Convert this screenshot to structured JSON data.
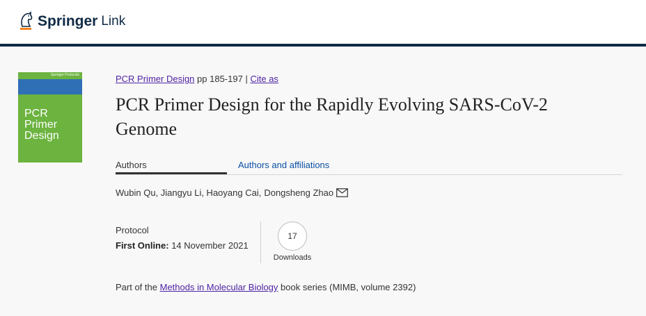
{
  "header": {
    "logo_brand": "Springer",
    "logo_product": "Link"
  },
  "cover": {
    "series_label": "Springer Protocols",
    "title_line1": "PCR Primer",
    "title_line2": "Design"
  },
  "breadcrumb": {
    "book_link": "PCR Primer Design",
    "pages": "pp 185-197",
    "separator": "|",
    "cite_link": "Cite as"
  },
  "chapter": {
    "title_line1": "PCR Primer Design for the Rapidly Evolving SARS-CoV-2",
    "title_line2": "Genome"
  },
  "tabs": {
    "authors": "Authors",
    "affiliations": "Authors and affiliations"
  },
  "authors": {
    "list": "Wubin Qu, Jiangyu Li, Haoyang Cai,",
    "last": "Dongsheng Zhao"
  },
  "meta": {
    "type": "Protocol",
    "first_online_label": "First Online:",
    "first_online_date": "14 November 2021",
    "downloads_count": "17",
    "downloads_label": "Downloads"
  },
  "series": {
    "prefix": "Part of the",
    "link": "Methods in Molecular Biology",
    "suffix": "book series (MIMB, volume 2392)"
  },
  "colors": {
    "brand_navy": "#0f2a44",
    "link_purple": "#4e24a5",
    "link_blue": "#0a4fa3",
    "cover_green": "#6cb33f"
  }
}
